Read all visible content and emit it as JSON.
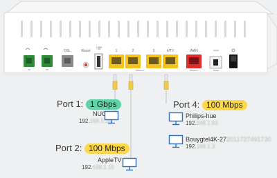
{
  "router": {
    "port_labels": [
      "Tel",
      "Tel",
      "DSL",
      "Reset",
      "USB",
      "1",
      "2",
      "Ethernet",
      "3",
      "4/TV",
      "WAN",
      "Ethernet",
      "Power"
    ],
    "colors": {
      "body": "#ffffff",
      "phone_port": "#2f8a3a",
      "dsl_port": "#8a8a8a",
      "lan_port": "#f5c11b",
      "wan_port": "#e02b2b"
    }
  },
  "ports": [
    {
      "title": "Port 1:",
      "speed": "1 Gbps",
      "speed_color": "green",
      "devices": [
        {
          "name": "NUC",
          "ip_prefix": "192.",
          "ip_hidden": "168.1.16",
          "icon": "monitor-icon"
        }
      ]
    },
    {
      "title": "Port 2:",
      "speed": "100 Mbps",
      "speed_color": "yellow",
      "devices": [
        {
          "name": "AppleTV",
          "ip_prefix": "192.",
          "ip_hidden": "168.1.15",
          "icon": "monitor-icon"
        }
      ]
    },
    {
      "title": "Port 4:",
      "speed": "100 Mbps",
      "speed_color": "yellow",
      "devices": [
        {
          "name": "Philips-hue",
          "ip_prefix": "192.",
          "ip_hidden": "168.1.63",
          "icon": "monitor-icon"
        },
        {
          "name": "Bouygtel4K-27",
          "name_hidden": "2011727491730",
          "ip_prefix": "192.",
          "ip_hidden": "168.1.3",
          "icon": "monitor-icon"
        }
      ]
    }
  ]
}
